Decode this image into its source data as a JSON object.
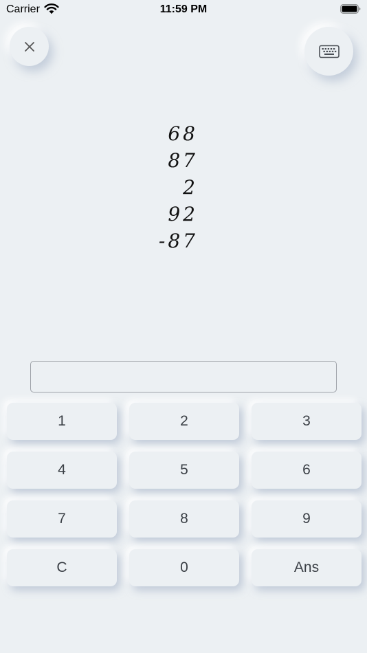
{
  "status_bar": {
    "carrier": "Carrier",
    "time": "11:59 PM"
  },
  "icons": {
    "close": "close-icon",
    "keyboard": "keyboard-icon",
    "wifi": "wifi-icon",
    "battery": "battery-icon"
  },
  "problem": {
    "lines": [
      "68",
      "87",
      "2",
      "92",
      "-87"
    ]
  },
  "answer": {
    "value": "",
    "placeholder": ""
  },
  "keypad": {
    "keys": [
      "1",
      "2",
      "3",
      "4",
      "5",
      "6",
      "7",
      "8",
      "9",
      "C",
      "0",
      "Ans"
    ]
  },
  "colors": {
    "background": "#ECF0F3",
    "key_text": "#3A3F45"
  }
}
